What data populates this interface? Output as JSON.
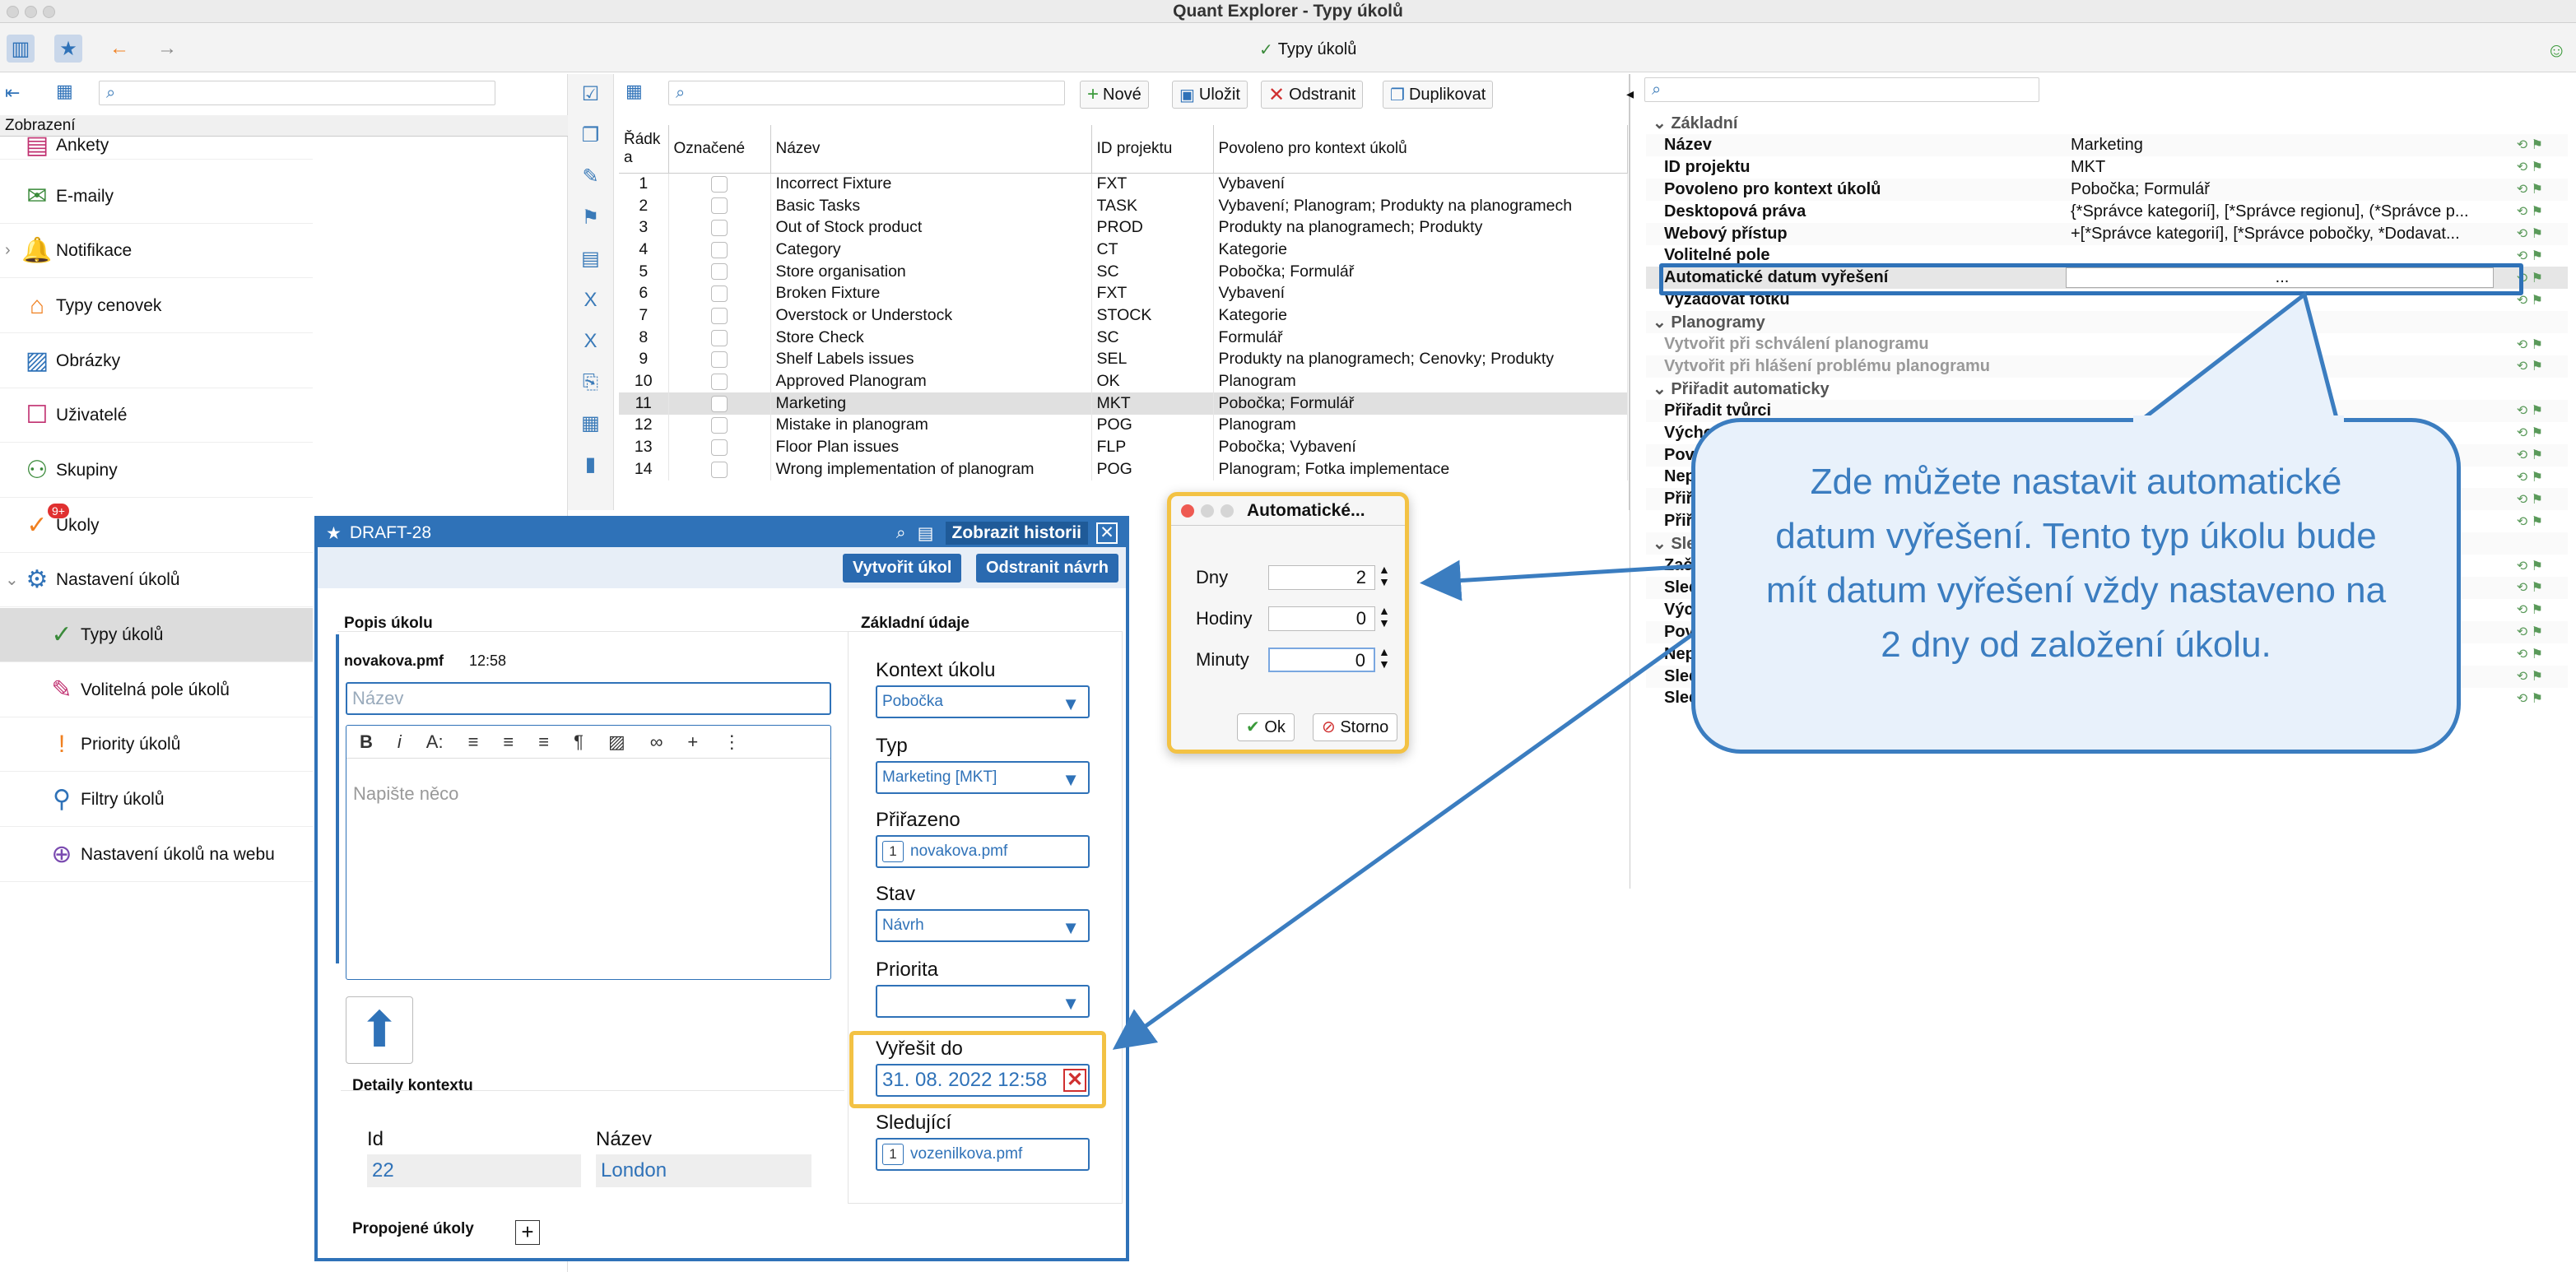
{
  "window": {
    "title": "Quant Explorer - Typy úkolů",
    "tab_title": "Typy úkolů"
  },
  "left": {
    "view_label": "Zobrazení",
    "items": [
      {
        "label": "Ankety",
        "icon": "survey-icon"
      },
      {
        "label": "E-maily",
        "icon": "email-icon"
      },
      {
        "label": "Notifikace",
        "icon": "notification-icon"
      },
      {
        "label": "Typy cenovek",
        "icon": "price-tag-icon"
      },
      {
        "label": "Obrázky",
        "icon": "image-icon"
      },
      {
        "label": "Uživatelé",
        "icon": "user-icon"
      },
      {
        "label": "Skupiny",
        "icon": "group-icon"
      },
      {
        "label": "Úkoly",
        "icon": "task-icon",
        "badge": "9+"
      },
      {
        "label": "Nastavení úkolů",
        "icon": "task-settings-icon"
      },
      {
        "label": "Typy úkolů",
        "icon": "task-type-icon"
      },
      {
        "label": "Volitelná pole úkolů",
        "icon": "optional-fields-icon"
      },
      {
        "label": "Priority úkolů",
        "icon": "priority-icon"
      },
      {
        "label": "Filtry úkolů",
        "icon": "filter-icon"
      },
      {
        "label": "Nastavení úkolů na webu",
        "icon": "web-settings-icon"
      }
    ]
  },
  "toolbar": {
    "new": "Nové",
    "save": "Uložit",
    "delete": "Odstranit",
    "duplicate": "Duplikovat"
  },
  "table": {
    "headers": {
      "row": "Řádk a",
      "marked": "Označené",
      "name": "Název",
      "project": "ID projektu",
      "context": "Povoleno pro kontext úkolů"
    },
    "rows": [
      {
        "n": "1",
        "name": "Incorrect Fixture",
        "id": "FXT",
        "ctx": "Vybavení"
      },
      {
        "n": "2",
        "name": "Basic Tasks",
        "id": "TASK",
        "ctx": "Vybavení; Planogram; Produkty na planogramech"
      },
      {
        "n": "3",
        "name": "Out of Stock product",
        "id": "PROD",
        "ctx": "Produkty na planogramech; Produkty"
      },
      {
        "n": "4",
        "name": "Category",
        "id": "CT",
        "ctx": "Kategorie"
      },
      {
        "n": "5",
        "name": "Store organisation",
        "id": "SC",
        "ctx": "Pobočka; Formulář"
      },
      {
        "n": "6",
        "name": "Broken Fixture",
        "id": "FXT",
        "ctx": "Vybavení"
      },
      {
        "n": "7",
        "name": "Overstock or Understock",
        "id": "STOCK",
        "ctx": "Kategorie"
      },
      {
        "n": "8",
        "name": "Store Check",
        "id": "SC",
        "ctx": "Formulář"
      },
      {
        "n": "9",
        "name": "Shelf Labels issues",
        "id": "SEL",
        "ctx": "Produkty na planogramech; Cenovky; Produkty"
      },
      {
        "n": "10",
        "name": "Approved Planogram",
        "id": "OK",
        "ctx": "Planogram"
      },
      {
        "n": "11",
        "name": "Marketing",
        "id": "MKT",
        "ctx": "Pobočka; Formulář"
      },
      {
        "n": "12",
        "name": "Mistake in planogram",
        "id": "POG",
        "ctx": "Planogram"
      },
      {
        "n": "13",
        "name": "Floor Plan issues",
        "id": "FLP",
        "ctx": "Pobočka; Vybavení"
      },
      {
        "n": "14",
        "name": "Wrong implementation of planogram",
        "id": "POG",
        "ctx": "Planogram; Fotka implementace"
      }
    ]
  },
  "props": {
    "rows": [
      {
        "k": "Základní",
        "v": "",
        "t": "grp"
      },
      {
        "k": "Název",
        "v": "Marketing"
      },
      {
        "k": "ID projektu",
        "v": "MKT"
      },
      {
        "k": "Povoleno pro kontext úkolů",
        "v": "Pobočka; Formulář"
      },
      {
        "k": "Desktopová práva",
        "v": "{*Správce kategorií], [*Správce regionu], (*Správce p..."
      },
      {
        "k": "Webový přístup",
        "v": "+[*Správce kategorií], [*Správce pobočky, *Dodavat..."
      },
      {
        "k": "Volitelné pole",
        "v": ""
      },
      {
        "k": "Automatické datum vyřešení",
        "v": "...",
        "t": "hl"
      },
      {
        "k": "Vyžadovat fotku",
        "v": ""
      },
      {
        "k": "Planogramy",
        "v": "",
        "t": "grp"
      },
      {
        "k": "Vytvořit při schválení planogramu",
        "v": "",
        "t": "dis"
      },
      {
        "k": "Vytvořit při hlášení problému planogramu",
        "v": "",
        "t": "dis"
      },
      {
        "k": "Přiřadit automaticky",
        "v": "",
        "t": "grp"
      },
      {
        "k": "Přiřadit tvůrci",
        "v": ""
      },
      {
        "k": "Výcho",
        "v": ""
      },
      {
        "k": "Pov",
        "v": ""
      },
      {
        "k": "Nep",
        "v": ""
      },
      {
        "k": "Přiř",
        "v": ""
      },
      {
        "k": "Přiř",
        "v": ""
      },
      {
        "k": "Sle",
        "v": "",
        "t": "grp"
      },
      {
        "k": "Zač",
        "v": ""
      },
      {
        "k": "Sled",
        "v": ""
      },
      {
        "k": "Výc",
        "v": ""
      },
      {
        "k": "Pov",
        "v": ""
      },
      {
        "k": "Nep",
        "v": ""
      },
      {
        "k": "Sled",
        "v": ""
      },
      {
        "k": "Sled",
        "v": ""
      }
    ]
  },
  "draft": {
    "title": "DRAFT-28",
    "history": "Zobrazit historii",
    "create": "Vytvořit úkol",
    "remove": "Odstranit návrh",
    "desc_title": "Popis úkolu",
    "author": "novakova.pmf",
    "time": "12:58",
    "name_placeholder": "Název",
    "editor_placeholder": "Napište něco",
    "ctx_title": "Detaily kontextu",
    "id_label": "Id",
    "id_value": "22",
    "name_label": "Název",
    "name_value": "London",
    "linked": "Propojené úkoly",
    "basic_title": "Základní údaje",
    "context_label": "Kontext úkolu",
    "context_value": "Pobočka",
    "type_label": "Typ",
    "type_value": "Marketing [MKT]",
    "assigned_label": "Přiřazeno",
    "assigned_value": "novakova.pmf",
    "state_label": "Stav",
    "state_value": "Návrh",
    "priority_label": "Priorita",
    "due_label": "Vyřešit do",
    "due_value": "31. 08. 2022 12:58",
    "followers_label": "Sledující",
    "followers_value": "vozenilkova.pmf",
    "chip": "1"
  },
  "dialog": {
    "title": "Automatické...",
    "days_label": "Dny",
    "days": "2",
    "hours_label": "Hodiny",
    "hours": "0",
    "minutes_label": "Minuty",
    "minutes": "0",
    "ok": "Ok",
    "cancel": "Storno"
  },
  "callout": {
    "text": "Zde můžete nastavit automatické datum vyřešení. Tento typ úkolu bude mít datum vyřešení vždy nastaveno na 2 dny od založení úkolu."
  },
  "colors": {
    "accent": "#2f72b8",
    "highlight": "#f3c244",
    "callout": "#3b7dc0"
  }
}
